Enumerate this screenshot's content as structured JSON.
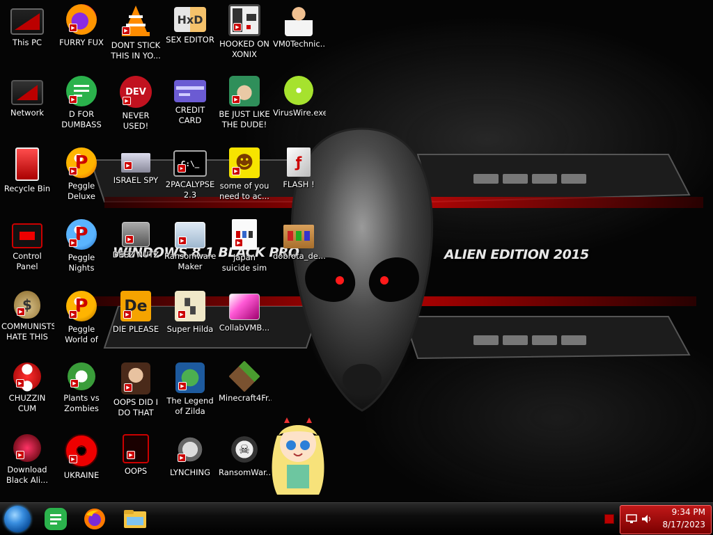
{
  "wallpaper": {
    "title_left": "WINDOWS 8.1 BLACK PRO",
    "title_right": "ALIEN EDITION 2015"
  },
  "desktop_icons": [
    {
      "label": "This PC",
      "icon": "computer-icon"
    },
    {
      "label": "FURRY FUX",
      "icon": "firefox-icon"
    },
    {
      "label": "DONT STICK THIS IN YO...",
      "icon": "vlc-cone-icon"
    },
    {
      "label": "SEX EDITOR",
      "icon": "hxd-editor-icon"
    },
    {
      "label": "HOOKED ON XONIX",
      "icon": "xonix-game-icon"
    },
    {
      "label": "VM0Technic...",
      "icon": "doctor-icon"
    },
    {
      "label": "Network",
      "icon": "network-icon"
    },
    {
      "label": "D FOR DUMBASS",
      "icon": "feedly-icon"
    },
    {
      "label": "NEVER USED!",
      "icon": "devcpp-icon"
    },
    {
      "label": "CREDIT CARD CHECKER",
      "icon": "credit-card-icon"
    },
    {
      "label": "BE JUST LIKE THE DUDE!",
      "icon": "elf-icon"
    },
    {
      "label": "VirusWire.exe",
      "icon": "lime-icon"
    },
    {
      "label": "Recycle Bin",
      "icon": "recycle-bin-icon"
    },
    {
      "label": "Peggle Deluxe",
      "icon": "peggle-icon"
    },
    {
      "label": "ISRAEL SPY",
      "icon": "remote-desktop-icon"
    },
    {
      "label": "2PACALYPSE 2.3",
      "icon": "terminal-icon"
    },
    {
      "label": "some of you need to ac...",
      "icon": "beaver-icon"
    },
    {
      "label": "FLASH !",
      "icon": "flash-document-icon"
    },
    {
      "label": "Control Panel",
      "icon": "control-panel-icon"
    },
    {
      "label": "Peggle Nights Deluxe",
      "icon": "peggle-icon"
    },
    {
      "label": "DEEZ NUTZ",
      "icon": "stacked-windows-icon"
    },
    {
      "label": "Ransomware Maker Build...",
      "icon": "app-window-icon"
    },
    {
      "label": "japan suicide sim",
      "icon": "document-icon"
    },
    {
      "label": "dobrota_de...",
      "icon": "archive-box-icon"
    },
    {
      "label": "COMMUNISTS HATE THIS G...",
      "icon": "money-bag-icon"
    },
    {
      "label": "Peggle World of Warcraft ...",
      "icon": "peggle-icon"
    },
    {
      "label": "DIE PLEASE",
      "icon": "de-logo-icon"
    },
    {
      "label": "Super Hilda",
      "icon": "pixel-character-icon"
    },
    {
      "label": "CollabVMB...",
      "icon": "pink-window-icon"
    },
    {
      "label": "CHUZZIN CUM",
      "icon": "chuzzle-icon"
    },
    {
      "label": "Plants vs Zombies",
      "icon": "plant-icon"
    },
    {
      "label": "OOPS DID I DO THAT",
      "icon": "portrait-icon"
    },
    {
      "label": "The Legend of Zilda",
      "icon": "pixel-hero-icon"
    },
    {
      "label": "Minecraft4Fr...",
      "icon": "grass-block-icon"
    },
    {
      "label": "Download Black Ali...",
      "icon": "alien-orb-icon"
    },
    {
      "label": "UKRAINE",
      "icon": "radiation-icon"
    },
    {
      "label": "OOPS",
      "icon": "app-shield-icon"
    },
    {
      "label": "LYNCHING",
      "icon": "gear-face-icon"
    },
    {
      "label": "RansomWar...",
      "icon": "skull-icon"
    }
  ],
  "taskbar": {
    "pinned": [
      "feedly-icon",
      "firefox-icon",
      "file-explorer-icon"
    ]
  },
  "tray": {
    "time": "9:34 PM",
    "date": "8/17/2023"
  },
  "colors": {
    "accent_red": "#c01818",
    "start_blue": "#3a8fe0"
  }
}
